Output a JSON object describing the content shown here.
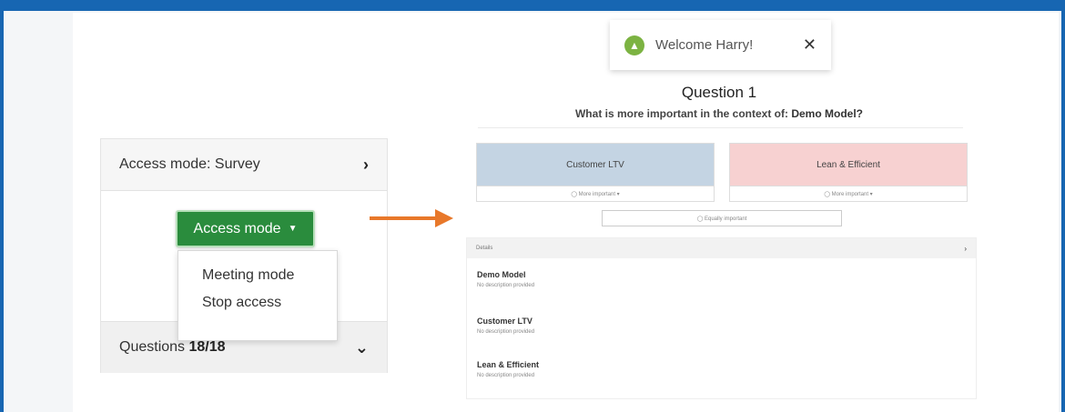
{
  "colors": {
    "frame": "#1766b2",
    "accent_green": "#2a8c3d",
    "arrow_orange": "#e8782a",
    "choice_blue": "#c4d4e3",
    "choice_red": "#f7d1d1"
  },
  "left_panel": {
    "access_header": "Access mode: Survey",
    "access_header_icon": "chevron-right-icon",
    "access_button": "Access mode",
    "dropdown": [
      "Meeting mode",
      "Stop access"
    ],
    "questions_label": "Questions",
    "questions_count": "18/18",
    "questions_icon": "chevron-down-icon"
  },
  "toast": {
    "icon": "success-icon",
    "message": "Welcome Harry!",
    "close": "✕"
  },
  "question": {
    "title": "Question 1",
    "subtitle_prefix": "What is more important in the context of:",
    "subtitle_model": "Demo Model?",
    "choices": [
      {
        "label": "Customer LTV",
        "sub": "◯ More important ▾"
      },
      {
        "label": "Lean & Efficient",
        "sub": "◯ More important ▾"
      }
    ],
    "equal_button": "◯ Equally important"
  },
  "details": {
    "header": "Details",
    "items": [
      {
        "name": "Demo Model",
        "desc": "No description provided"
      },
      {
        "name": "Customer LTV",
        "desc": "No description provided"
      },
      {
        "name": "Lean & Efficient",
        "desc": "No description provided"
      }
    ]
  }
}
